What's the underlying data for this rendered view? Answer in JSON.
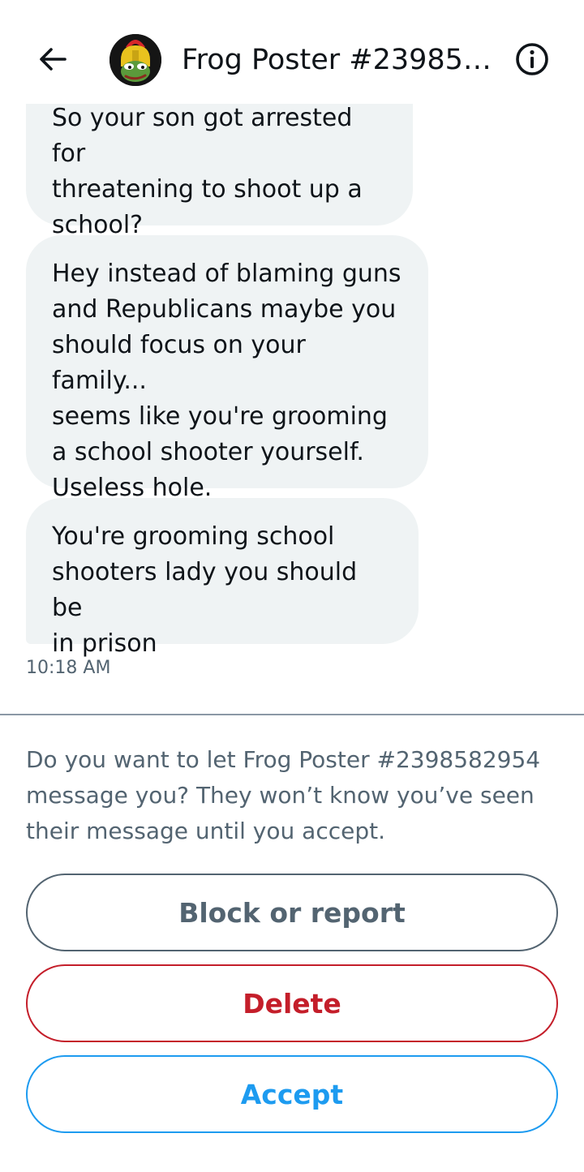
{
  "header": {
    "title": "Frog Poster #2398582954",
    "back_icon": "arrow-left-icon",
    "info_icon": "info-circle-icon",
    "avatar_icon": "frog-helmet-avatar"
  },
  "messages": [
    {
      "text": "So your son got arrested for\nthreatening to shoot up a\nschool?"
    },
    {
      "text": "Hey instead of blaming guns\nand Republicans maybe you\nshould focus on your family...\nseems like you're grooming\na school shooter yourself.\nUseless hole."
    },
    {
      "text": "You're grooming school\nshooters lady you should be\nin prison"
    }
  ],
  "timestamp": "10:18 AM",
  "request": {
    "prompt": "Do you want to let Frog Poster #2398582954 message you? They won’t know you’ve seen their message until you accept.",
    "block_label": "Block or report",
    "delete_label": "Delete",
    "accept_label": "Accept"
  },
  "colors": {
    "bubble": "#eff3f4",
    "secondary_text": "#536471",
    "delete": "#c41e2a",
    "accept": "#1d9bf0"
  }
}
